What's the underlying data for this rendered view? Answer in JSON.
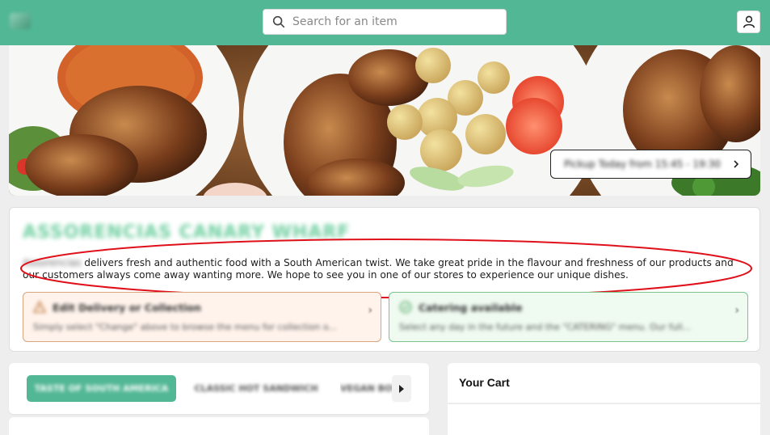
{
  "header": {
    "logo_icon": "brand-logo-icon",
    "search_placeholder": "Search for an item",
    "search_icon": "search-icon",
    "user_icon": "user-icon",
    "accent_color": "#52b795"
  },
  "hero": {
    "image_alt": "Grilled chicken plates with rice, potatoes and tomato",
    "pickup_text": "Pickup Today from 15:45 - 19:30"
  },
  "store": {
    "name": "ASSORENCIAS CANARY WHARF",
    "brand": "Assorencias",
    "description": " delivers fresh and authentic food with a South American twist. We take great pride in the flavour and freshness of our products and our customers always come away wanting more. We hope to see you in one of our stores to experience our unique dishes."
  },
  "promos": [
    {
      "title": "Edit Delivery or Collection",
      "subtitle": "Simply select \"Change\" above to browse the menu for collection o...",
      "icon": "warning-icon",
      "color": "#fff3ec"
    },
    {
      "title": "Catering available",
      "subtitle": "Select any day in the future and the \"CATERING\" menu. Our full...",
      "icon": "check-circle-icon",
      "color": "#effaf0"
    }
  ],
  "categories": {
    "items": [
      "TASTE OF SOUTH AMERICA",
      "CLASSIC HOT SANDWICH",
      "VEGAN BOWLS"
    ],
    "active_index": 0
  },
  "cart": {
    "title": "Your Cart"
  }
}
